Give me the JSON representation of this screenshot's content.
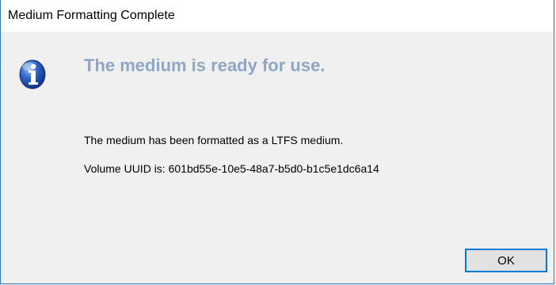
{
  "window": {
    "title": "Medium Formatting Complete"
  },
  "dialog": {
    "icon": "info-icon",
    "headline": "The medium is ready for use.",
    "message_line_1": "The medium has been formatted as a LTFS medium.",
    "message_line_2": "Volume UUID is: 601bd55e-10e5-48a7-b5d0-b1c5e1dc6a14"
  },
  "buttons": {
    "ok_label": "OK"
  },
  "colors": {
    "headline": "#8fa6c4",
    "window_border": "#2b78c2",
    "button_focus": "#0078d7",
    "background": "#f0f0f0"
  }
}
